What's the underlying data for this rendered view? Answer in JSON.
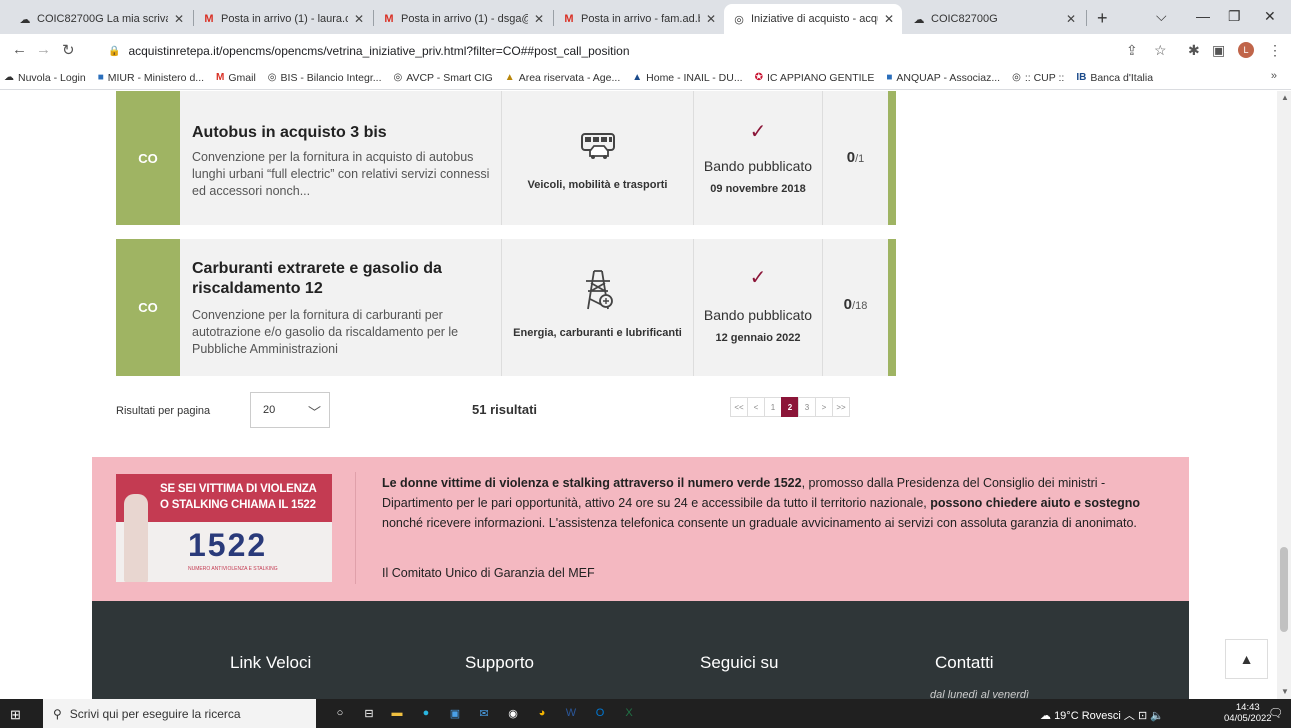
{
  "browser": {
    "tabs": [
      {
        "title": "COIC82700G La mia scrivania",
        "icon": "cloud-icon"
      },
      {
        "title": "Posta in arrivo (1) - laura.dr.la",
        "icon": "gmail-icon"
      },
      {
        "title": "Posta in arrivo (1) - dsga@ica",
        "icon": "gmail-icon"
      },
      {
        "title": "Posta in arrivo - fam.ad.biffi@",
        "icon": "gmail-icon"
      },
      {
        "title": "Iniziative di acquisto - acquist",
        "icon": "globe-icon"
      },
      {
        "title": "COIC82700G",
        "icon": "cloud-icon"
      }
    ],
    "active_tab": 4,
    "url": "acquistinretepa.it/opencms/opencms/vetrina_iniziative_priv.html?filter=CO##post_call_position",
    "profile_initial": "L",
    "bookmarks": [
      {
        "label": "Nuvola - Login",
        "icon": "cloud-icon"
      },
      {
        "label": "MIUR - Ministero d...",
        "icon": "miur-icon"
      },
      {
        "label": "Gmail",
        "icon": "gmail-icon"
      },
      {
        "label": "BIS - Bilancio Integr...",
        "icon": "globe-icon"
      },
      {
        "label": "AVCP - Smart CIG",
        "icon": "globe-icon"
      },
      {
        "label": "Area riservata - Age...",
        "icon": "agency-icon"
      },
      {
        "label": "Home - INAIL - DU...",
        "icon": "inail-icon"
      },
      {
        "label": "IC APPIANO GENTILE",
        "icon": "school-icon"
      },
      {
        "label": "ANQUAP - Associaz...",
        "icon": "anquap-icon"
      },
      {
        "label": ":: CUP ::",
        "icon": "globe-icon"
      },
      {
        "label": "Banca d'Italia",
        "icon": "bank-icon"
      }
    ],
    "bookmarks_more": "»"
  },
  "cards": [
    {
      "tag": "CO",
      "title": "Autobus in acquisto 3 bis",
      "description": "Convenzione per la fornitura in acquisto di autobus lunghi urbani “full electric” con relativi servizi connessi ed accessori nonch...",
      "category": "Veicoli, mobilità e trasporti",
      "category_icon": "vehicles-icon",
      "status": "Bando pubblicato",
      "date": "09 novembre 2018",
      "count": "0",
      "count_total": "/1"
    },
    {
      "tag": "CO",
      "title": "Carburanti extrarete e gasolio da riscaldamento 12",
      "description": "Convenzione per la fornitura di carburanti per autotrazione e/o gasolio da riscaldamento per le Pubbliche Amministrazioni",
      "category": "Energia, carburanti e lubrificanti",
      "category_icon": "energy-tower-icon",
      "status": "Bando pubblicato",
      "date": "12 gennaio 2022",
      "count": "0",
      "count_total": "/18"
    }
  ],
  "pagination": {
    "per_page_label": "Risultati per pagina",
    "per_page_value": "20",
    "results": "51 risultati",
    "first": "<<",
    "prev": "<",
    "pages": [
      "1",
      "2",
      "3"
    ],
    "current_page": "2",
    "next": ">",
    "last": ">>"
  },
  "banner": {
    "image_line1": "SE SEI VITTIMA DI VIOLENZA",
    "image_line2": "O STALKING CHIAMA IL 1522",
    "image_number": "1522",
    "image_small": "NUMERO ANTIVIOLENZA E STALKING",
    "text_bold1": "Le donne vittime di violenza e stalking attraverso il numero verde 1522",
    "text_part1": ", promosso dalla Presidenza del Consiglio dei ministri - Dipartimento per le pari opportunità, attivo 24 ore su 24 e accessibile da tutto il territorio nazionale, ",
    "text_bold2": "possono chiedere aiuto e sostegno",
    "text_part2": " nonché ricevere informazioni. L'assistenza telefonica consente un graduale avvicinamento ai servizi con assoluta garanzia di anonimato.",
    "link": "Il Comitato Unico di Garanzia del MEF"
  },
  "footer": {
    "headings": [
      "Link Veloci",
      "Supporto",
      "Seguici su",
      "Contatti"
    ],
    "contatti_sub": "dal lunedì al venerdì"
  },
  "taskbar": {
    "search_placeholder": "Scrivi qui per eseguire la ricerca",
    "weather": "19°C Rovesci",
    "time": "14:43",
    "date": "04/05/2022",
    "notifications": "5"
  },
  "colors": {
    "accent": "#8b1538",
    "card_tag": "#9fb463",
    "banner_bg": "#f4b8c1",
    "footer_bg": "#2f3638"
  }
}
